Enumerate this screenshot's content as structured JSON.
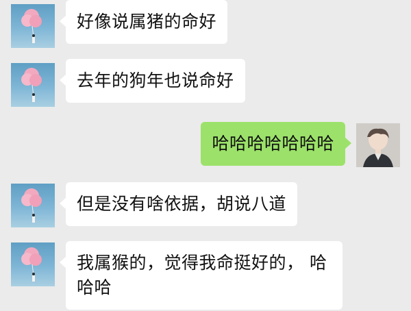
{
  "conversation": {
    "messages": [
      {
        "side": "left",
        "avatar": "cotton-candy-girl-avatar",
        "text": "好像说属猪的命好"
      },
      {
        "side": "left",
        "avatar": "cotton-candy-girl-avatar",
        "text": "去年的狗年也说命好"
      },
      {
        "side": "right",
        "avatar": "boy-portrait-avatar",
        "text": "哈哈哈哈哈哈哈"
      },
      {
        "side": "left",
        "avatar": "cotton-candy-girl-avatar",
        "text": "但是没有啥依据，胡说八道"
      },
      {
        "side": "left",
        "avatar": "cotton-candy-girl-avatar",
        "text": "我属猴的，觉得我命挺好的， 哈哈哈"
      }
    ]
  },
  "colors": {
    "background": "#ebebeb",
    "incoming_bubble": "#ffffff",
    "outgoing_bubble": "#9ce26a"
  }
}
